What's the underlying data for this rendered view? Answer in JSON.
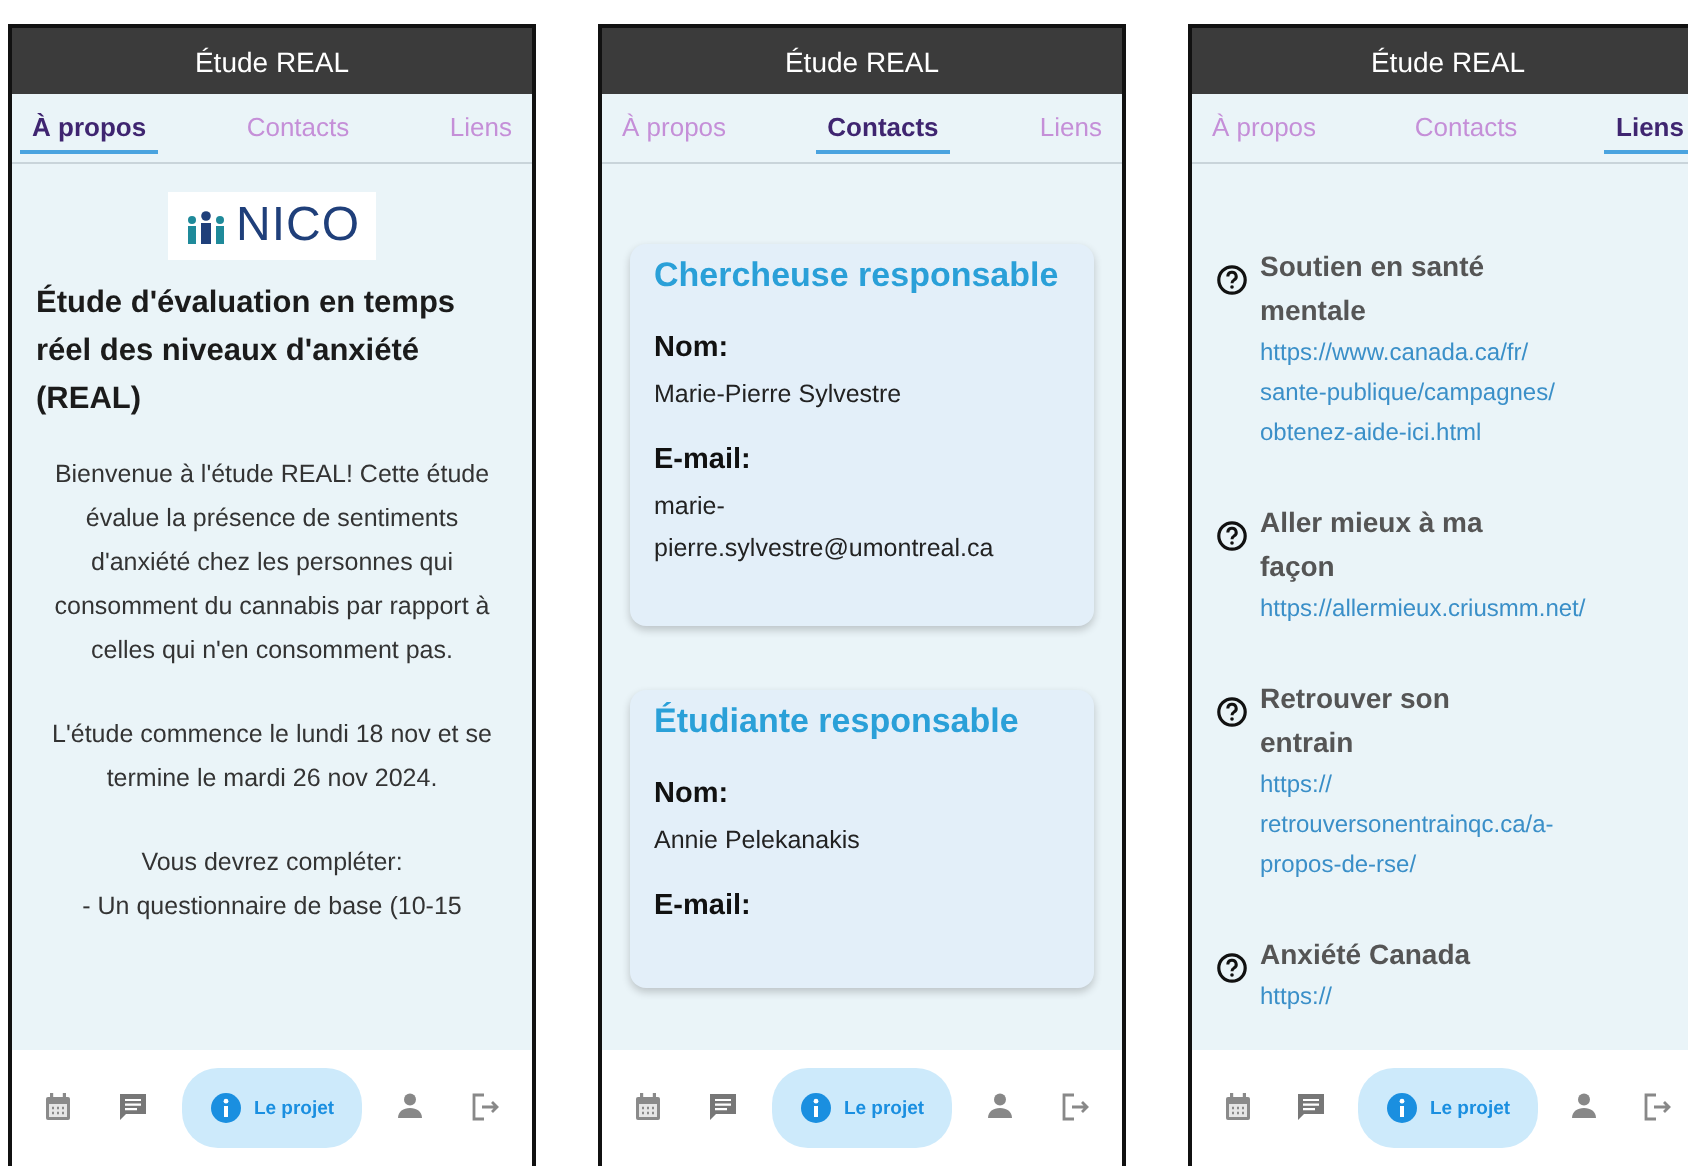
{
  "phones": [
    {
      "title": "Étude REAL",
      "tabs": [
        {
          "label": "À propos",
          "selected": true
        },
        {
          "label": "Contacts",
          "selected": false
        },
        {
          "label": "Liens",
          "selected": false
        }
      ],
      "content": {
        "kind": "about",
        "logo": "NICO",
        "heading": "Étude d'évaluation en temps réel des niveaux d'anxiété (REAL)",
        "paragraphs": [
          "Bienvenue à l'étude REAL! Cette étude évalue la présence de sentiments d'anxiété chez les personnes qui consomment du cannabis par rapport à celles qui n'en consomment pas.",
          "L'étude commence le lundi 18 nov et se termine le mardi 26 nov 2024.",
          "Vous devrez compléter:\n- Un questionnaire de base (10-15"
        ]
      },
      "nav": [
        {
          "selected": false
        },
        {
          "selected": false
        },
        {
          "selected": true,
          "label": "Le projet"
        },
        {
          "selected": false
        },
        {
          "selected": false
        }
      ]
    },
    {
      "title": "Étude REAL",
      "tabs": [
        {
          "label": "À propos",
          "selected": false
        },
        {
          "label": "Contacts",
          "selected": true
        },
        {
          "label": "Liens",
          "selected": false
        }
      ],
      "content": {
        "kind": "contacts",
        "cards": [
          {
            "heading": "Chercheuse responsable",
            "fields": [
              {
                "label": "Nom:",
                "value": "Marie-Pierre Sylvestre"
              },
              {
                "label": "E-mail:",
                "value": "marie-\npierre.sylvestre@umontreal.ca"
              }
            ]
          },
          {
            "heading": "Étudiante responsable",
            "fields": [
              {
                "label": "Nom:",
                "value": "Annie Pelekanakis"
              },
              {
                "label": "E-mail:"
              }
            ]
          }
        ]
      },
      "nav": [
        {
          "selected": false
        },
        {
          "selected": false
        },
        {
          "selected": true,
          "label": "Le projet"
        },
        {
          "selected": false
        },
        {
          "selected": false
        }
      ]
    },
    {
      "title": "Étude REAL",
      "tabs": [
        {
          "label": "À propos",
          "selected": false
        },
        {
          "label": "Contacts",
          "selected": false
        },
        {
          "label": "Liens",
          "selected": true
        }
      ],
      "content": {
        "kind": "links",
        "links": [
          {
            "title": "Soutien en santé mentale",
            "url": "https://www.canada.ca/fr/\nsante-publique/campagnes/\nobtenez-aide-ici.html"
          },
          {
            "title": "Aller mieux à ma façon",
            "url": "https://allermieux.criusmm.net/"
          },
          {
            "title": "Retrouver son entrain",
            "url": "https://\nretrouversonentrainqc.ca/a-\npropos-de-rse/"
          },
          {
            "title": "Anxiété Canada",
            "url": "https://"
          }
        ]
      },
      "nav": [
        {
          "selected": false
        },
        {
          "selected": false
        },
        {
          "selected": true,
          "label": "Le projet"
        },
        {
          "selected": false
        },
        {
          "selected": false
        }
      ]
    }
  ]
}
